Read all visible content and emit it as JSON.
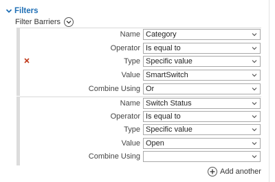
{
  "section": {
    "title": "Filters",
    "chevron_icon": "chevron-down-icon"
  },
  "filter_barriers": {
    "title": "Filter Barriers",
    "expand_icon": "chevron-down-circle-icon"
  },
  "groups": [
    {
      "rows": [
        {
          "label": "Name",
          "value": "Category"
        },
        {
          "label": "Operator",
          "value": "Is equal to"
        },
        {
          "label": "Type",
          "value": "Specific value"
        },
        {
          "label": "Value",
          "value": "SmartSwitch"
        },
        {
          "label": "Combine Using",
          "value": "Or"
        }
      ],
      "remove_icon": "close-icon"
    },
    {
      "rows": [
        {
          "label": "Name",
          "value": "Switch Status"
        },
        {
          "label": "Operator",
          "value": "Is equal to"
        },
        {
          "label": "Type",
          "value": "Specific value"
        },
        {
          "label": "Value",
          "value": "Open"
        },
        {
          "label": "Combine Using",
          "value": ""
        }
      ]
    }
  ],
  "add_another": {
    "label": "Add another",
    "icon": "plus-circle-icon"
  },
  "colors": {
    "accent": "#1f6fb5",
    "remove": "#c0391b",
    "border": "#a8a8a8",
    "group_bar": "#dcdcdc"
  }
}
